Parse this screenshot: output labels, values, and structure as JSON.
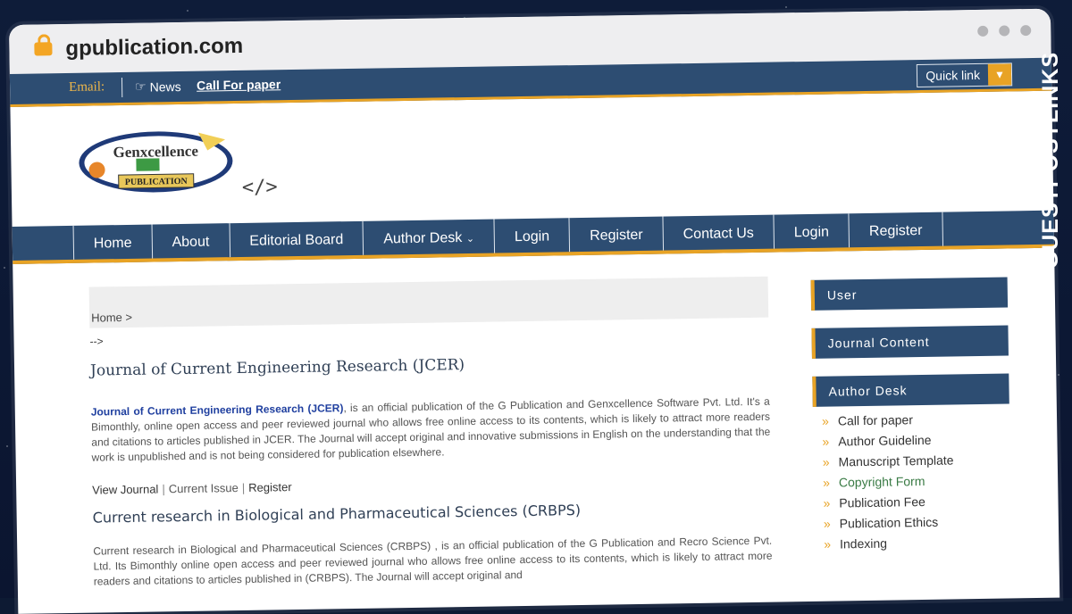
{
  "browser": {
    "url": "gpublication.com"
  },
  "topbar": {
    "email_label": "Email:",
    "news_label": "News",
    "call_for_paper": "Call For paper",
    "quick_link": "Quick link"
  },
  "logo": {
    "line1": "Genxcellence",
    "line2": "PUBLICATION"
  },
  "code_placeholder": "</>",
  "nav": [
    "Home",
    "About",
    "Editorial Board",
    "Author Desk",
    "Login",
    "Register",
    "Contact Us",
    "Login",
    "Register"
  ],
  "breadcrumb": {
    "home": "Home >",
    "arrow": "-->"
  },
  "journal1": {
    "title": "Journal of Current Engineering Research (JCER)",
    "name": "Journal of Current Engineering Research (JCER)",
    "desc": ", is an official publication of the G Publication and Genxcellence Software Pvt. Ltd. It's a Bimonthly, online open access and peer reviewed journal who allows free online access to its contents, which is likely to attract more readers and citations to articles published in JCER. The Journal will accept original and innovative submissions in English on the understanding that the work is unpublished and is not being considered for publication elsewhere."
  },
  "journal_links": {
    "view": "View Journal",
    "current": "Current Issue",
    "register": "Register",
    "sep": "|"
  },
  "journal2": {
    "title": "Current research in Biological and Pharmaceutical Sciences (CRBPS)",
    "desc": "Current research in Biological and Pharmaceutical Sciences (CRBPS) , is an official publication of the G Publication and Recro Science Pvt. Ltd. Its Bimonthly online open access and peer reviewed journal who allows free online access to its contents, which is likely to attract more readers and citations to articles published in (CRBPS). The Journal will accept original and"
  },
  "sidebar": {
    "user": "User",
    "journal_content": "Journal Content",
    "author_desk": "Author Desk",
    "items": [
      "Call for paper",
      "Author Guideline",
      "Manuscript Template",
      "Copyright Form",
      "Publication Fee",
      "Publication Ethics",
      "Indexing"
    ]
  },
  "brand": {
    "text": "GUESTPOSTLINKS"
  },
  "colors": {
    "nav": "#2d4d72",
    "accent": "#e8a325"
  }
}
